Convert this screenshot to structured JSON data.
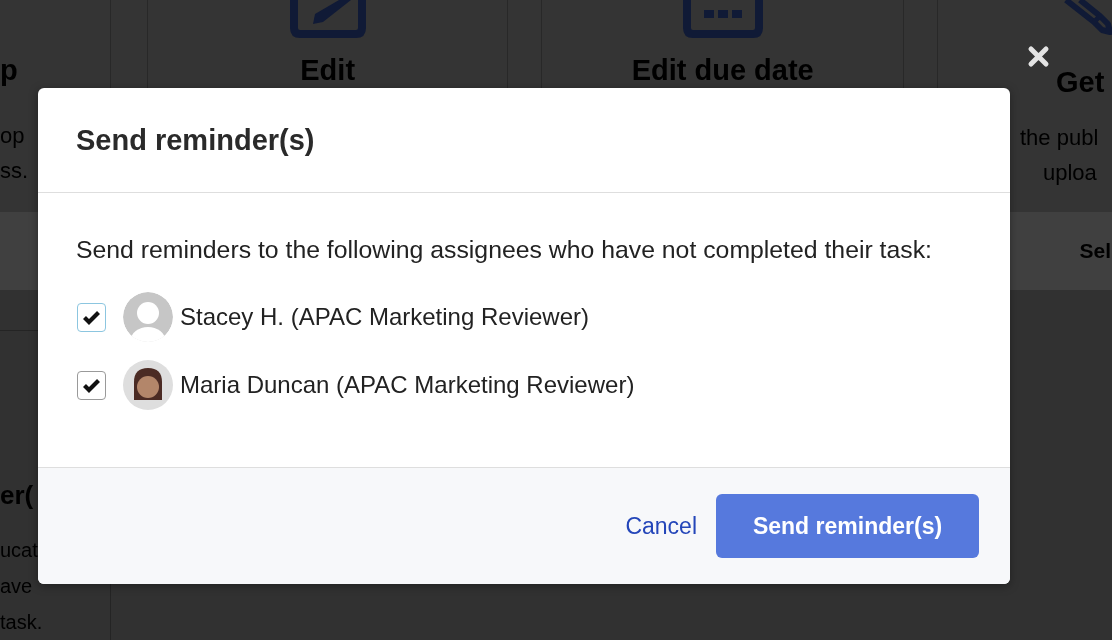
{
  "background": {
    "cards": [
      {
        "kind": "plain",
        "title": "p",
        "description": [
          "op",
          "ss."
        ]
      },
      {
        "kind": "pencil-box",
        "title": "Edit"
      },
      {
        "kind": "calendar",
        "title": "Edit due date"
      },
      {
        "kind": "pencil",
        "title": "Get",
        "description": [
          "the publ",
          "uploa"
        ]
      }
    ],
    "action_bar": {
      "label": "Sel"
    },
    "lower_card": {
      "title": "er(",
      "description": [
        "ucat",
        "ave",
        "task."
      ]
    }
  },
  "dialog": {
    "title": "Send reminder(s)",
    "message": "Send reminders to the following assignees who have not completed their task:",
    "assignees": [
      {
        "kind": "default-avatar",
        "name": "Stacey H. (APAC Marketing Reviewer)",
        "checked": true,
        "focused": true
      },
      {
        "kind": "custom-avatar",
        "name": "Maria Duncan (APAC Marketing Reviewer)",
        "checked": true,
        "focused": false
      }
    ],
    "cancel": "Cancel",
    "submit": "Send reminder(s)"
  }
}
